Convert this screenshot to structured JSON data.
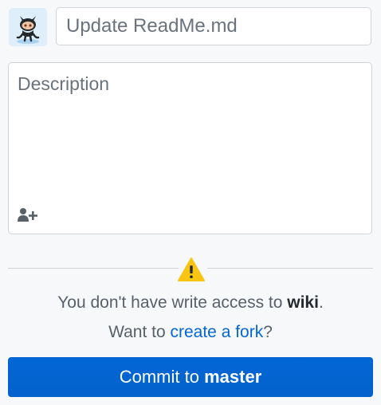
{
  "commit": {
    "avatar_icon": "octocat-icon",
    "summary_placeholder": "Update ReadMe.md",
    "description_placeholder": "Description",
    "coauthor_icon": "person-add-icon"
  },
  "access_notice": {
    "warning_icon": "alert-triangle-icon",
    "message_prefix": "You don't have write access to ",
    "repo_name": "wiki",
    "message_suffix": ".",
    "fork_prefix": "Want to ",
    "fork_link": "create a fork",
    "fork_suffix": "?"
  },
  "commit_button": {
    "prefix": "Commit to ",
    "branch": "master"
  },
  "colors": {
    "accent": "#0366d6",
    "warning": "#f9c513",
    "background": "#f6f8fa"
  }
}
